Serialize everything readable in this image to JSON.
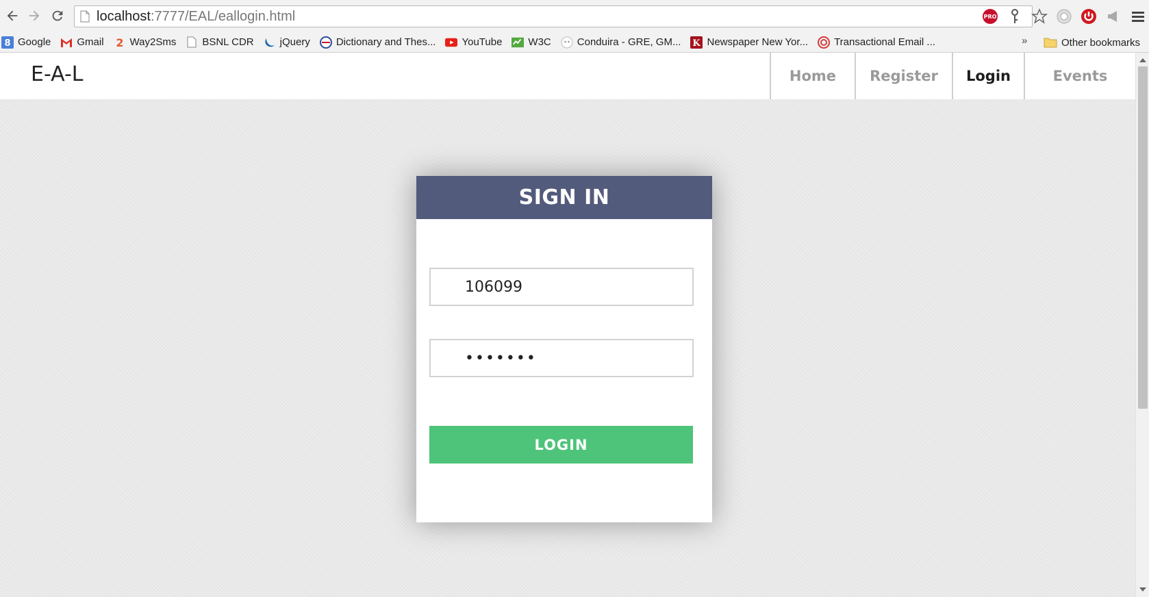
{
  "browser": {
    "url_host": "localhost",
    "url_path": ":7777/EAL/eallogin.html",
    "bookmarks": [
      {
        "label": "Google",
        "icon": "google-icon"
      },
      {
        "label": "Gmail",
        "icon": "gmail-icon"
      },
      {
        "label": "Way2Sms",
        "icon": "way2sms-icon"
      },
      {
        "label": "BSNL CDR",
        "icon": "page-icon"
      },
      {
        "label": "jQuery",
        "icon": "jquery-icon"
      },
      {
        "label": "Dictionary and Thes...",
        "icon": "dictionary-icon"
      },
      {
        "label": "YouTube",
        "icon": "youtube-icon"
      },
      {
        "label": "W3C",
        "icon": "w3c-icon"
      },
      {
        "label": "Conduira - GRE, GM...",
        "icon": "conduira-icon"
      },
      {
        "label": "Newspaper New Yor...",
        "icon": "newspaper-icon"
      },
      {
        "label": "Transactional Email ...",
        "icon": "email-target-icon"
      }
    ],
    "more": "»",
    "other_bookmarks": "Other bookmarks"
  },
  "site": {
    "brand": "E-A-L",
    "nav": [
      {
        "label": "Home",
        "active": false
      },
      {
        "label": "Register",
        "active": false
      },
      {
        "label": "Login",
        "active": true
      },
      {
        "label": "Events",
        "active": false
      }
    ]
  },
  "signin": {
    "title": "SIGN IN",
    "username_value": "106099",
    "password_value": "•••••••",
    "login_label": "LOGIN"
  },
  "colors": {
    "card_header": "#525b7b",
    "login_button": "#4ec47a",
    "background": "#e9e9e9"
  }
}
